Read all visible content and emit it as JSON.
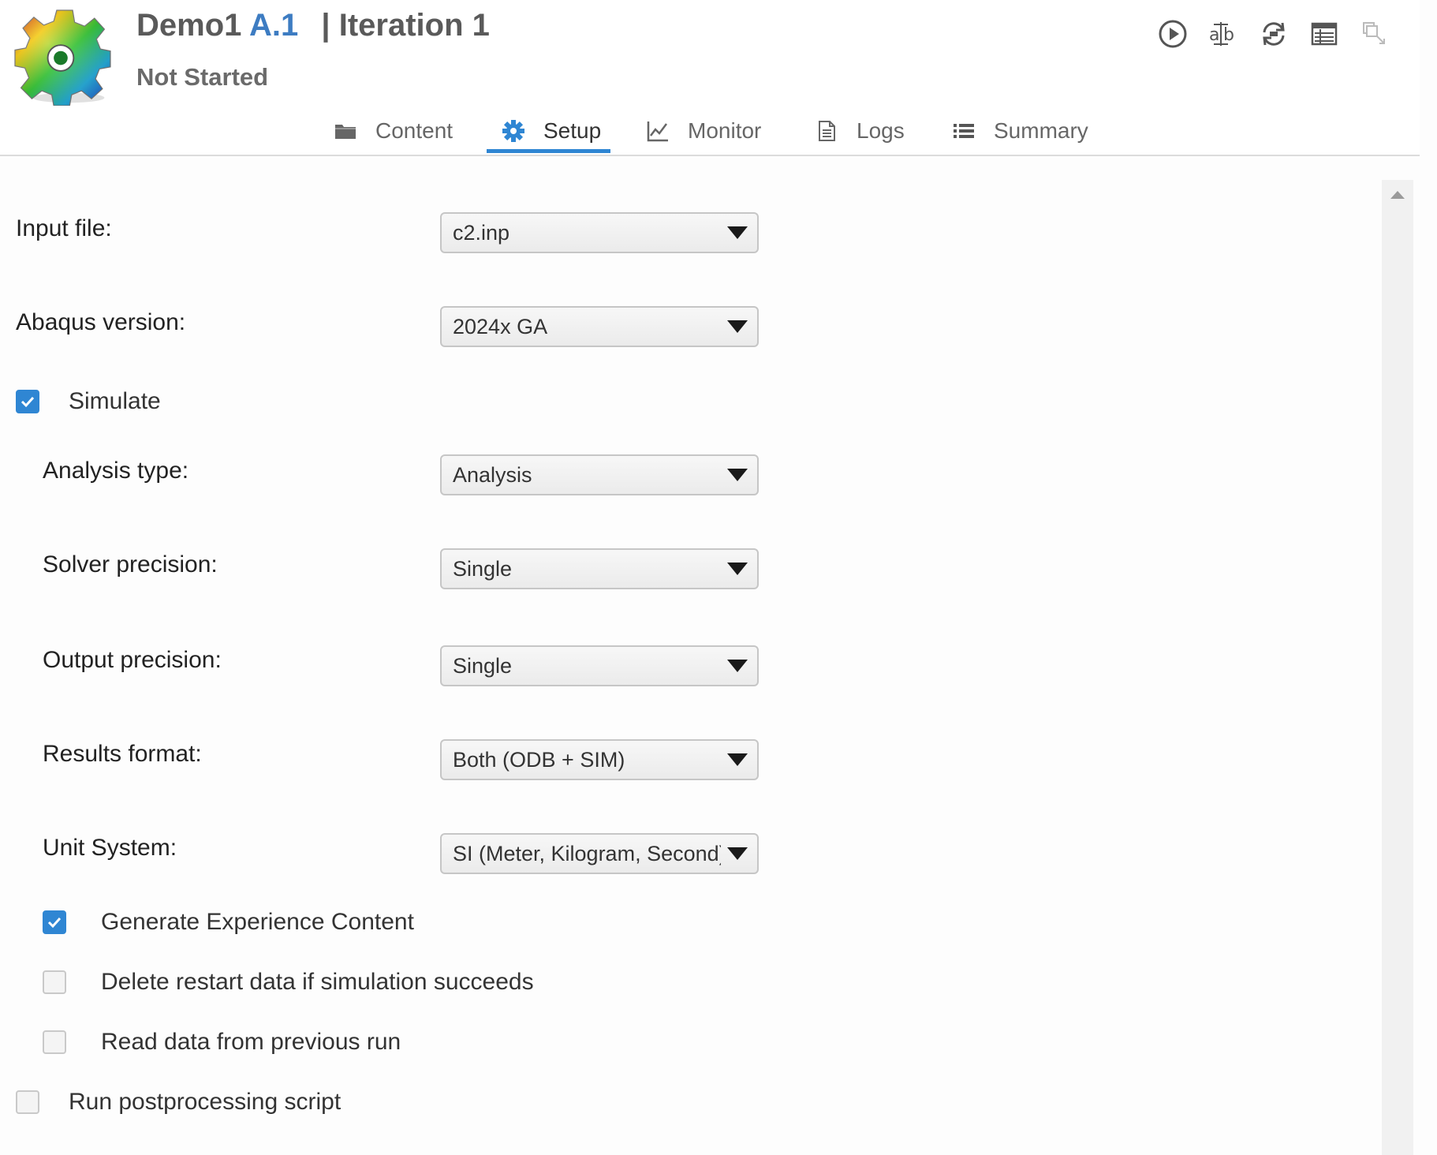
{
  "header": {
    "project": "Demo1",
    "revision": "A.1",
    "separator": "|",
    "iteration": "Iteration 1",
    "status": "Not Started"
  },
  "toolbar": {
    "icons": [
      "play-icon",
      "spell-check-icon",
      "sync-icon",
      "table-icon",
      "tag-disabled-icon"
    ]
  },
  "tabs": [
    {
      "label": "Content",
      "icon": "folder-icon",
      "active": false
    },
    {
      "label": "Setup",
      "icon": "gear-icon",
      "active": true
    },
    {
      "label": "Monitor",
      "icon": "line-chart-icon",
      "active": false
    },
    {
      "label": "Logs",
      "icon": "document-icon",
      "active": false
    },
    {
      "label": "Summary",
      "icon": "list-icon",
      "active": false
    }
  ],
  "setup": {
    "input_file": {
      "label": "Input file:",
      "value": "c2.inp"
    },
    "abaqus_version": {
      "label": "Abaqus version:",
      "value": "2024x GA"
    },
    "simulate": {
      "label": "Simulate",
      "checked": true
    },
    "analysis_type": {
      "label": "Analysis type:",
      "value": "Analysis"
    },
    "solver_precision": {
      "label": "Solver precision:",
      "value": "Single"
    },
    "output_precision": {
      "label": "Output precision:",
      "value": "Single"
    },
    "results_format": {
      "label": "Results format:",
      "value": "Both (ODB + SIM)"
    },
    "unit_system": {
      "label": "Unit System:",
      "value": "SI (Meter, Kilogram, Second)"
    },
    "generate_experience": {
      "label": "Generate Experience Content",
      "checked": true
    },
    "delete_restart": {
      "label": "Delete restart data if simulation succeeds",
      "checked": false
    },
    "read_previous": {
      "label": "Read data from previous run",
      "checked": false
    },
    "run_postprocessing": {
      "label": "Run postprocessing script",
      "checked": false
    }
  },
  "colors": {
    "accent": "#2f86d3",
    "revision": "#3d7cc2"
  }
}
